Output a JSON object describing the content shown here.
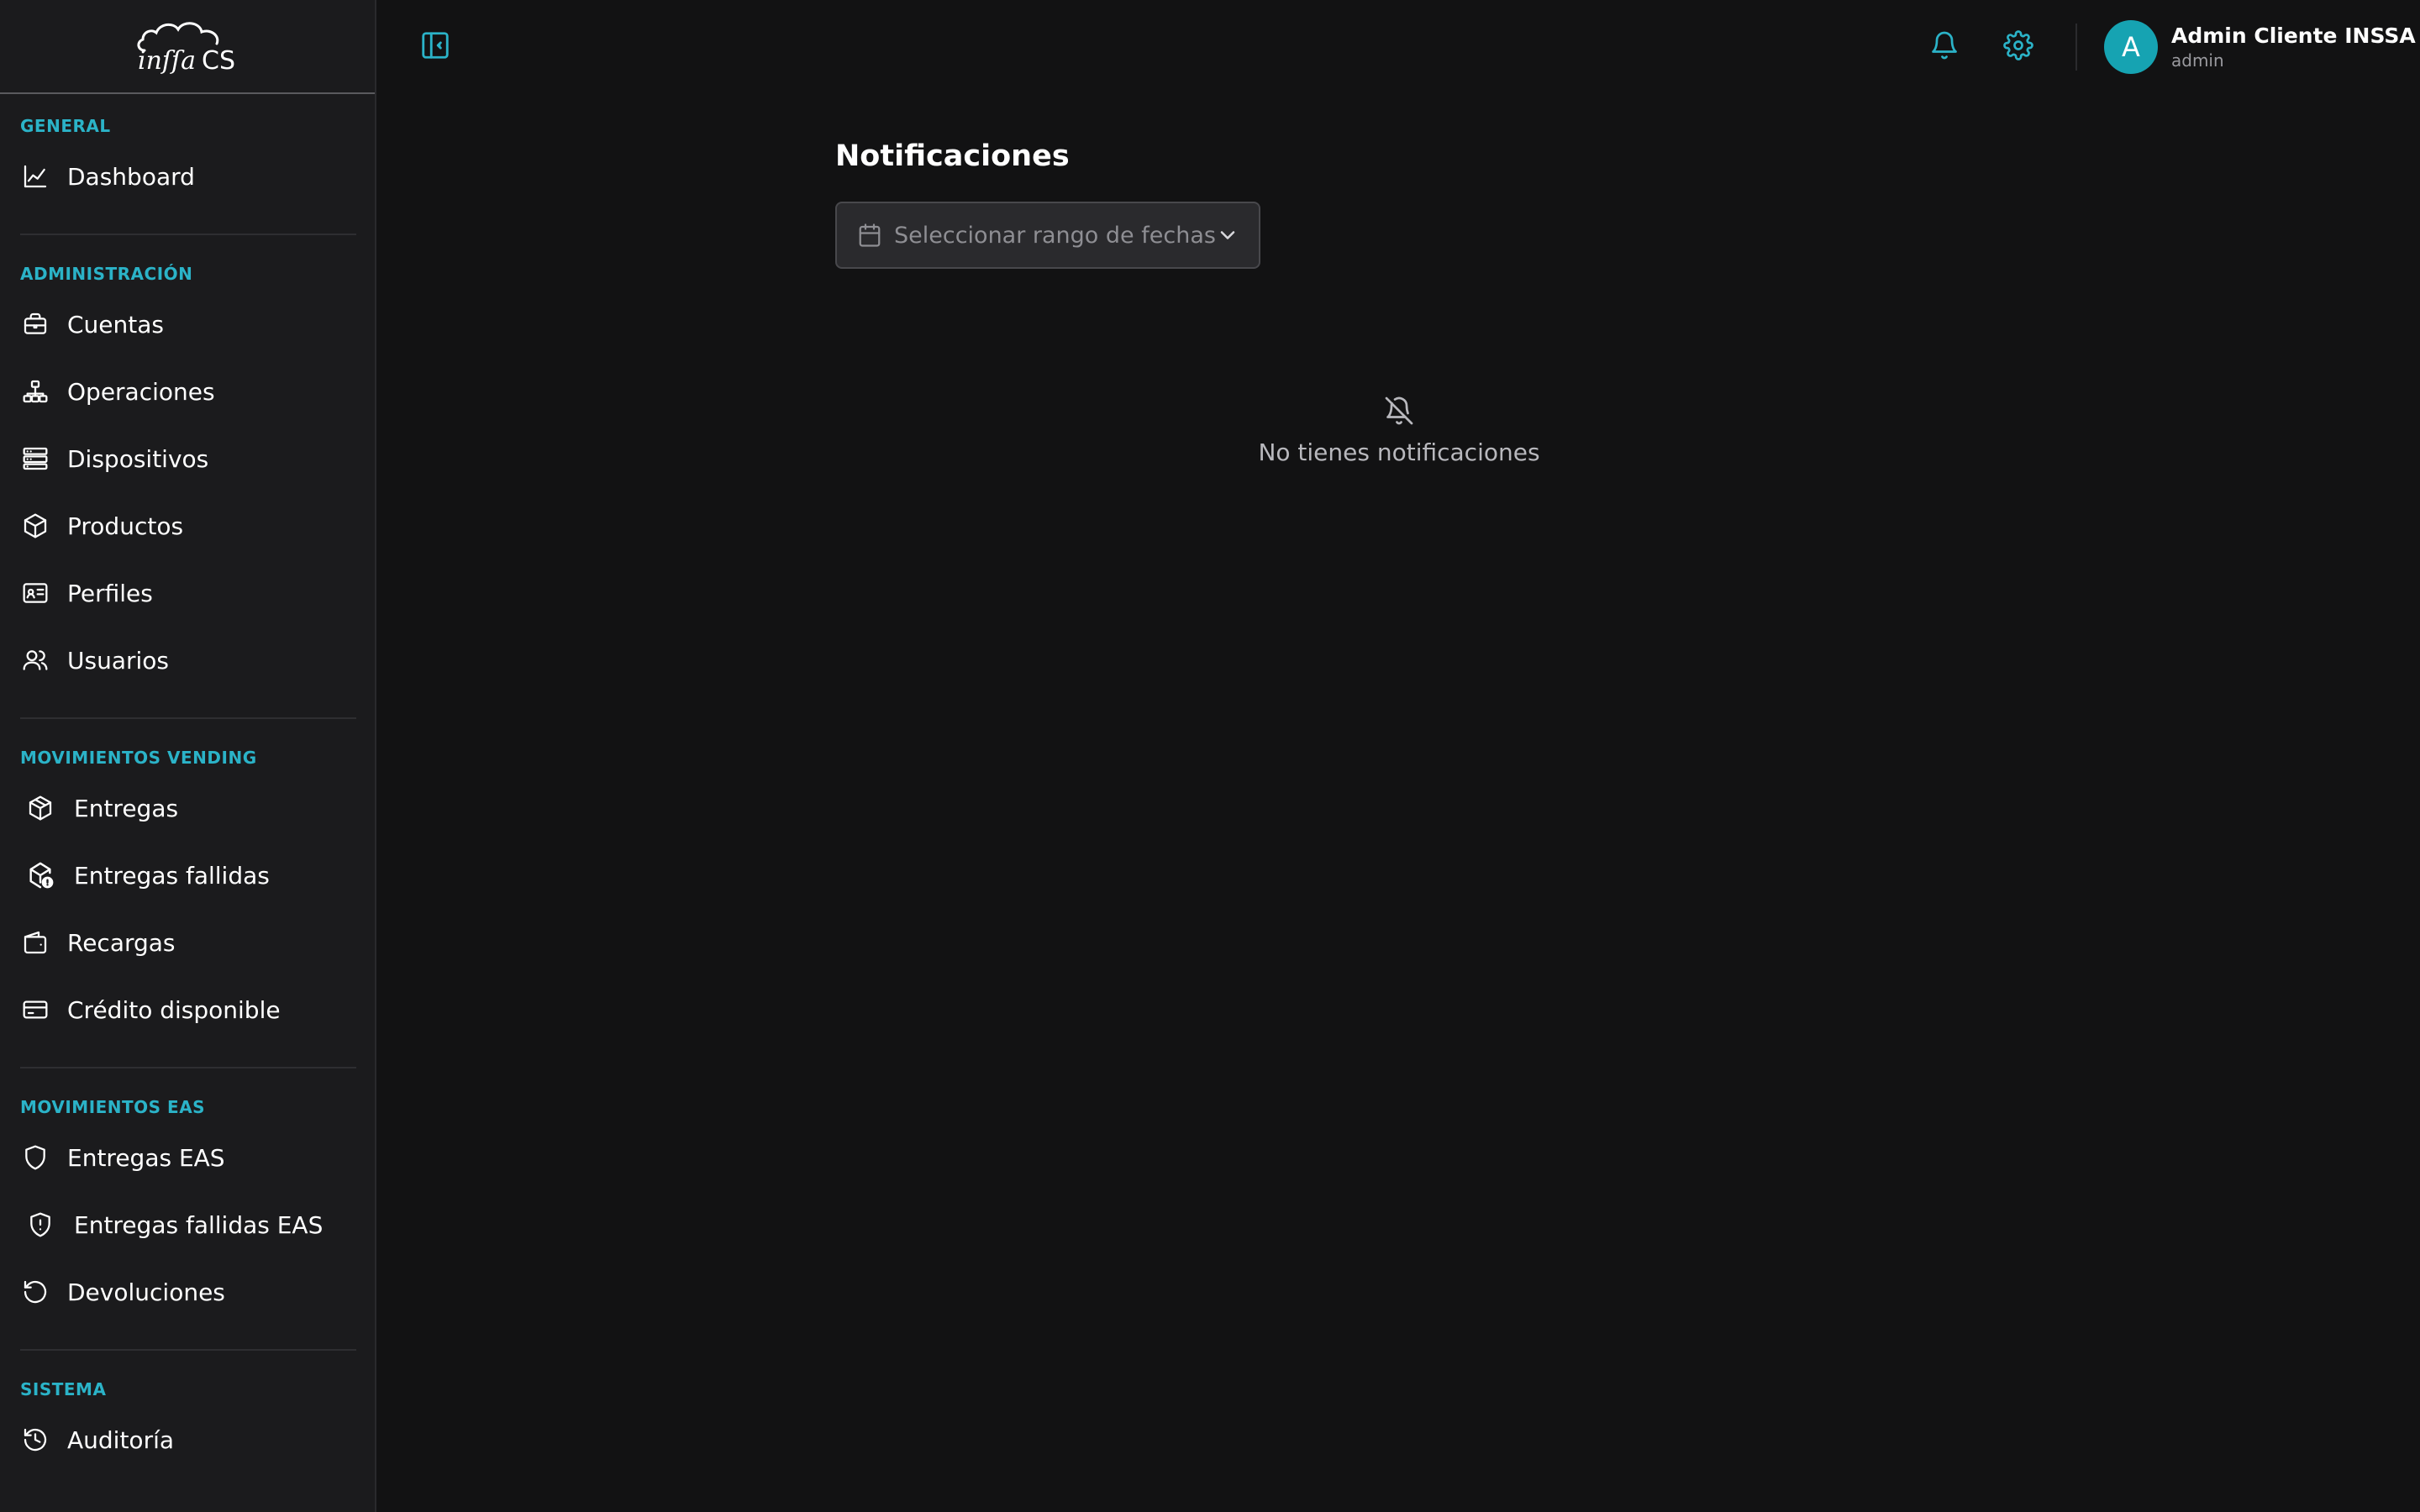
{
  "app": {
    "logo_text": "inssa CS"
  },
  "sidebar": {
    "sections": [
      {
        "label": "GENERAL",
        "items": [
          {
            "label": "Dashboard",
            "icon": "chart-line-icon"
          }
        ]
      },
      {
        "label": "ADMINISTRACIÓN",
        "items": [
          {
            "label": "Cuentas",
            "icon": "briefcase-icon"
          },
          {
            "label": "Operaciones",
            "icon": "network-icon"
          },
          {
            "label": "Dispositivos",
            "icon": "server-icon"
          },
          {
            "label": "Productos",
            "icon": "box-icon"
          },
          {
            "label": "Perfiles",
            "icon": "id-card-icon"
          },
          {
            "label": "Usuarios",
            "icon": "users-icon"
          }
        ]
      },
      {
        "label": "MOVIMIENTOS VENDING",
        "items": [
          {
            "label": "Entregas",
            "icon": "package-icon"
          },
          {
            "label": "Entregas fallidas",
            "icon": "package-alert-icon"
          },
          {
            "label": "Recargas",
            "icon": "wallet-icon"
          },
          {
            "label": "Crédito disponible",
            "icon": "credit-card-icon"
          }
        ]
      },
      {
        "label": "MOVIMIENTOS EAS",
        "items": [
          {
            "label": "Entregas EAS",
            "icon": "shield-icon"
          },
          {
            "label": "Entregas fallidas EAS",
            "icon": "shield-alert-icon"
          },
          {
            "label": "Devoluciones",
            "icon": "rotate-ccw-icon"
          }
        ]
      },
      {
        "label": "SISTEMA",
        "items": [
          {
            "label": "Auditoría",
            "icon": "history-icon"
          }
        ]
      }
    ]
  },
  "header": {
    "toggle_icon": "sidebar-toggle-icon",
    "bell_icon": "bell-icon",
    "settings_icon": "gear-icon",
    "user": {
      "avatar_initial": "A",
      "name": "Admin Cliente INSSA",
      "role": "admin"
    },
    "accent_color": "#2bb3c8"
  },
  "main": {
    "title": "Notificaciones",
    "date_range": {
      "placeholder": "Seleccionar rango de fechas"
    },
    "empty_state": {
      "icon": "bell-off-icon",
      "text": "No tienes notificaciones"
    }
  }
}
